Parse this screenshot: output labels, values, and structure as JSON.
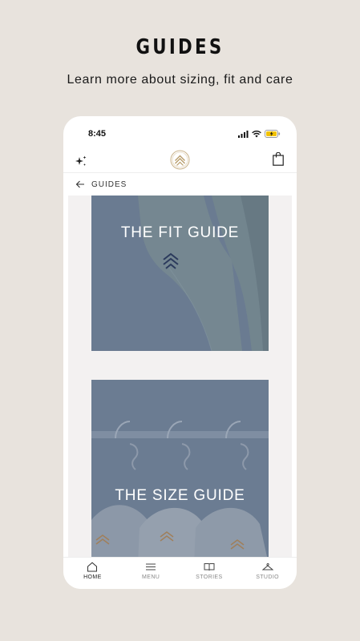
{
  "promo": {
    "title": "GUIDES",
    "subtitle": "Learn more about sizing, fit and care"
  },
  "status_bar": {
    "time": "8:45"
  },
  "icons": {
    "sparkle": "sparkle-icon",
    "logo": "brand-logo",
    "bag": "shopping-bag-icon",
    "back": "arrow-left-icon",
    "home": "home-icon",
    "menu": "hamburger-menu-icon",
    "stories": "book-icon",
    "studio": "hanger-icon"
  },
  "breadcrumb": {
    "label": "GUIDES"
  },
  "guides": [
    {
      "title": "THE FIT GUIDE"
    },
    {
      "title": "THE SIZE GUIDE"
    }
  ],
  "tabbar": {
    "items": [
      {
        "label": "HOME",
        "active": true
      },
      {
        "label": "MENU",
        "active": false
      },
      {
        "label": "STORIES",
        "active": false
      },
      {
        "label": "STUDIO",
        "active": false
      }
    ]
  },
  "colors": {
    "background": "#e8e3dd",
    "card_overlay": "#67778d",
    "content_bg": "#f3f1f1"
  }
}
